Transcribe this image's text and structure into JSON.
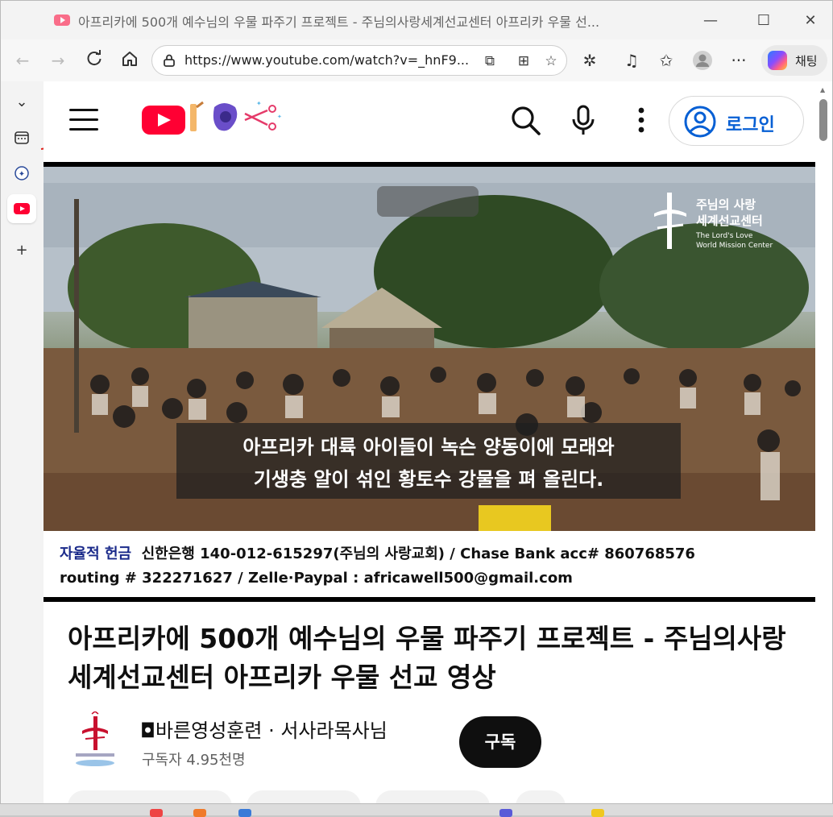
{
  "tab": {
    "title": "아프리카에 500개 예수님의 우물 파주기 프로젝트 - 주님의사랑세계선교센터 아프리카 우물 선..."
  },
  "window_controls": {
    "minimize": "—",
    "maximize": "☐",
    "close": "✕"
  },
  "address_bar": {
    "url": "https://www.youtube.com/watch?v=_hnF9..."
  },
  "copilot": {
    "label": "채팅"
  },
  "youtube": {
    "login_label": "로그인"
  },
  "video": {
    "overlay_church_name_1": "주님의 사랑",
    "overlay_church_name_2": "세계선교센터",
    "overlay_church_en_1": "The Lord's Love",
    "overlay_church_en_2": "World Mission Center",
    "caption_line_1": "아프리카 대륙 아이들이 녹슨 양동이에 모래와",
    "caption_line_2": "기생충 알이 섞인 황토수 강물을 펴 올린다.",
    "donation_lead": "자율적 헌금",
    "donation_line_1": "신한은행 140-012-615297(주님의 사랑교회) / Chase Bank acc# 860768576",
    "donation_line_2": "routing # 322271627 /  Zelle·Paypal : africawell500@gmail.com"
  },
  "watch": {
    "title": "아프리카에 500개 예수님의 우물 파주기 프로젝트 - 주님의사랑세계선교센터 아프리카 우물 선교 영상",
    "channel_name": "◘바른영성훈련 · 서사라목사님",
    "subscribers": "구독자 4.95천명",
    "subscribe_label": "구독"
  },
  "colors": {
    "youtube_red": "#ff0033",
    "link_blue": "#065fd4",
    "donation_blue": "#1a2a8a"
  }
}
